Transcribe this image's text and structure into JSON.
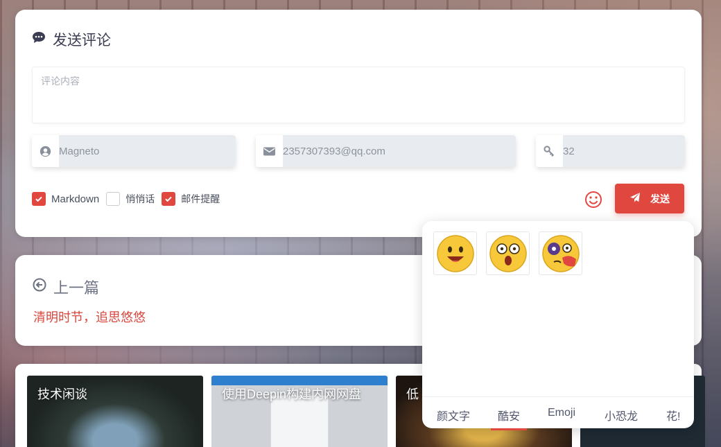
{
  "comment_form": {
    "title": "发送评论",
    "textarea_placeholder": "评论内容",
    "name_value": "Magneto",
    "email_value": "2357307393@qq.com",
    "site_value": "32",
    "options": [
      {
        "label": "Markdown",
        "checked": true
      },
      {
        "label": "悄悄话",
        "checked": false
      },
      {
        "label": "邮件提醒",
        "checked": true
      }
    ],
    "send_label": "发送",
    "accent_color": "#e0473f"
  },
  "prev_post": {
    "heading": "上一篇",
    "title": "清明时节，追思悠悠"
  },
  "related_posts": [
    {
      "title": "技术闲谈"
    },
    {
      "title": "使用Deepin构建内网网盘"
    },
    {
      "title": "低"
    }
  ],
  "emoji_panel": {
    "tabs": [
      "颜文字",
      "酷安",
      "Emoji",
      "小恐龙",
      "花!"
    ],
    "active_tab": "酷安",
    "emojis": [
      "happy-face-icon",
      "shocked-face-icon",
      "hurt-face-icon"
    ]
  }
}
